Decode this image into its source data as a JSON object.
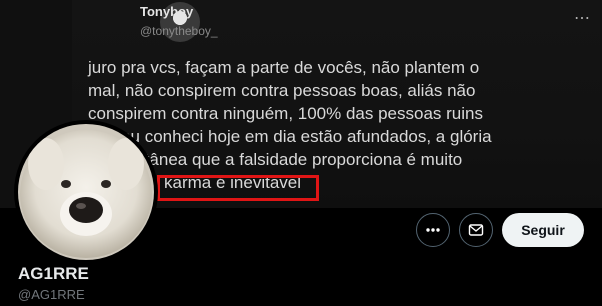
{
  "embedded_tweet": {
    "author_name": "Tonyboy",
    "author_handle": "@tonytheboy_",
    "lines": [
      "juro pra vcs, façam a parte de vocês, não plantem o",
      "mal, não conspirem contra pessoas boas, aliás não",
      "conspirem contra ninguém, 100% das pessoas ruins",
      "que eu conheci hoje em dia estão afundados, a glória",
      "momentânea que a falsidade proporciona é muito",
      "karma é inevitavel"
    ],
    "highlight_color": "#e01515"
  },
  "profile": {
    "display_name": "AG1RRE",
    "username": "@AG1RRE"
  },
  "actions": {
    "more_icon": "more-horizontal-icon",
    "message_icon": "mail-icon",
    "follow_label": "Seguir"
  }
}
